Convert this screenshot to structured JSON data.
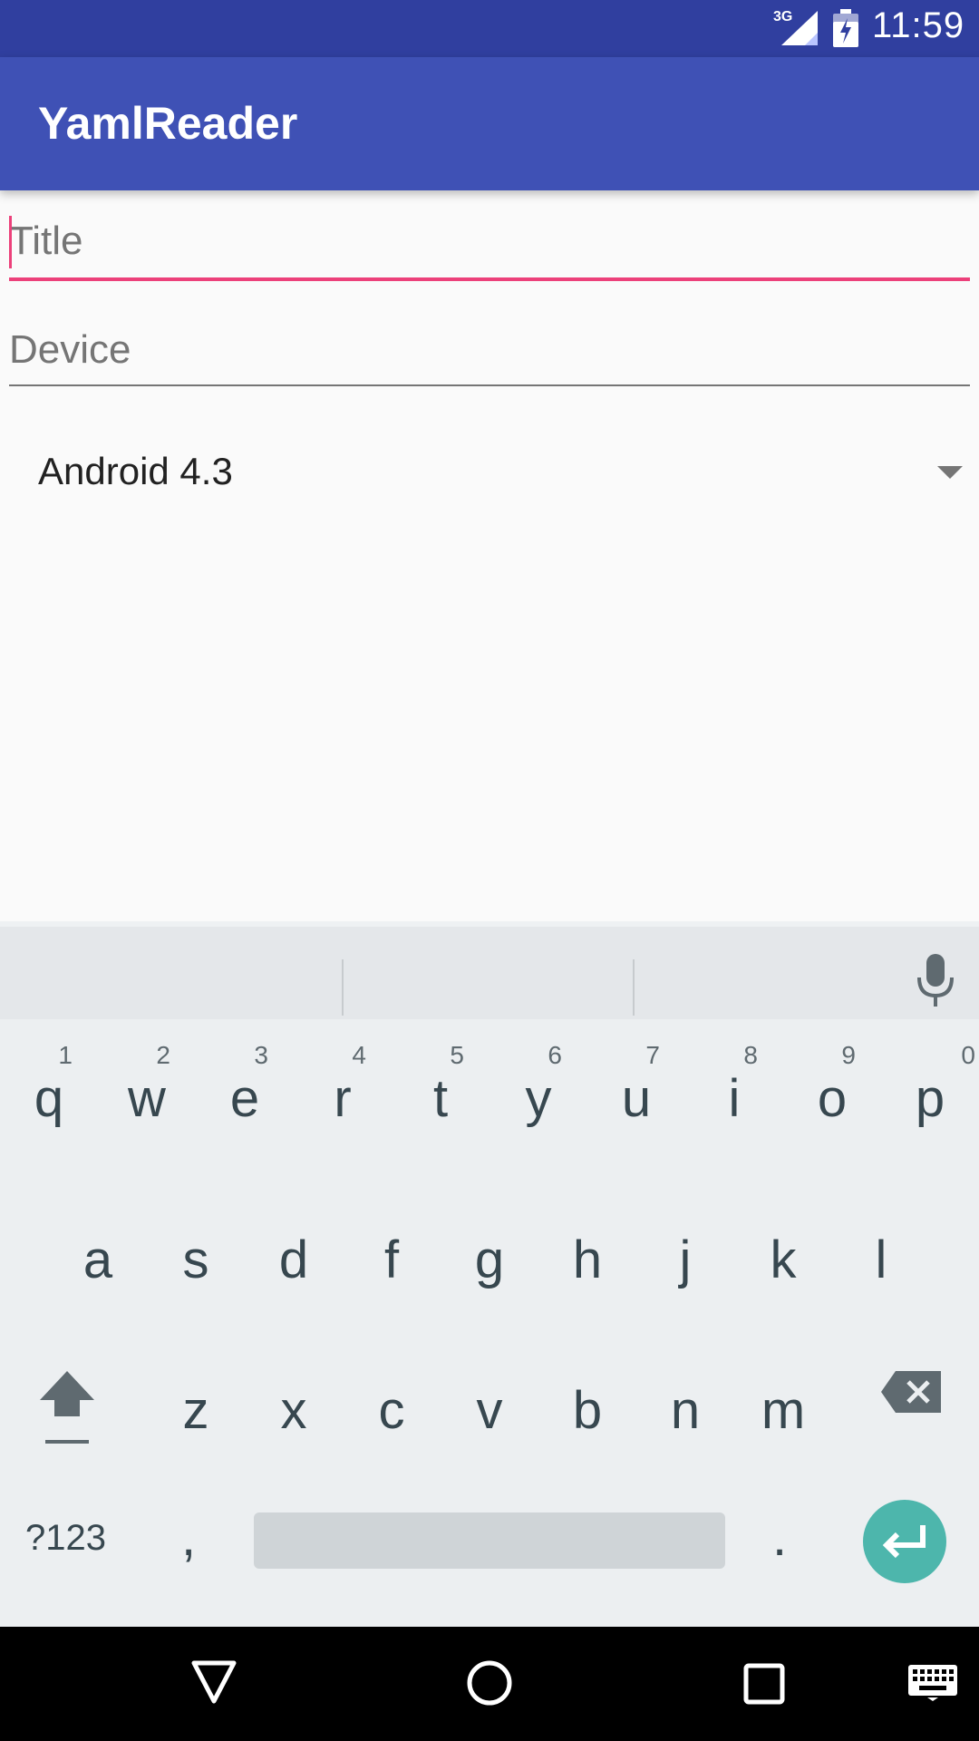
{
  "status_bar": {
    "network": "3G",
    "time": "11:59"
  },
  "app_bar": {
    "title": "YamlReader"
  },
  "form": {
    "title_field": {
      "value": "",
      "placeholder": "Title"
    },
    "device_field": {
      "value": "",
      "placeholder": "Device"
    },
    "os_spinner": {
      "selected": "Android 4.3"
    }
  },
  "keyboard": {
    "row1": [
      {
        "letter": "q",
        "hint": "1"
      },
      {
        "letter": "w",
        "hint": "2"
      },
      {
        "letter": "e",
        "hint": "3"
      },
      {
        "letter": "r",
        "hint": "4"
      },
      {
        "letter": "t",
        "hint": "5"
      },
      {
        "letter": "y",
        "hint": "6"
      },
      {
        "letter": "u",
        "hint": "7"
      },
      {
        "letter": "i",
        "hint": "8"
      },
      {
        "letter": "o",
        "hint": "9"
      },
      {
        "letter": "p",
        "hint": "0"
      }
    ],
    "row2": [
      "a",
      "s",
      "d",
      "f",
      "g",
      "h",
      "j",
      "k",
      "l"
    ],
    "row3": [
      "z",
      "x",
      "c",
      "v",
      "b",
      "n",
      "m"
    ],
    "symbols_label": "?123",
    "comma_label": ",",
    "period_label": "."
  },
  "colors": {
    "status_bar": "#303f9f",
    "app_bar": "#3f51b5",
    "accent": "#ec407a",
    "enter_key": "#4db6ac"
  }
}
